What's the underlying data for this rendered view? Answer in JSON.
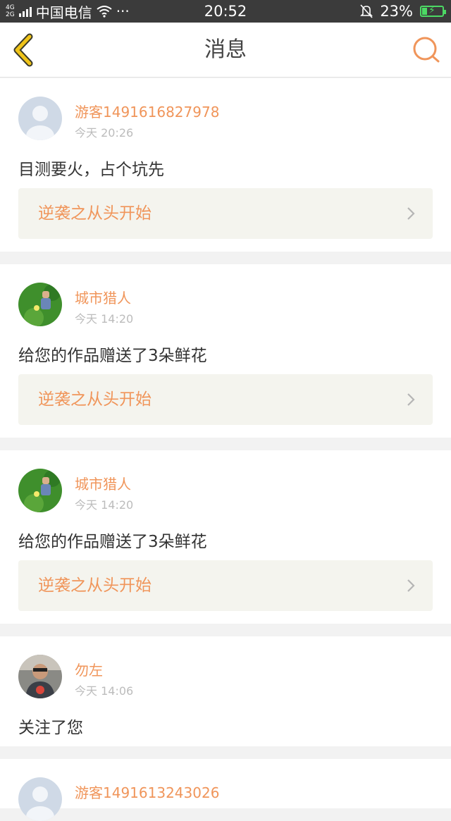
{
  "status_bar": {
    "network_top": "4G",
    "network_bottom": "2G",
    "carrier": "中国电信",
    "more": "···",
    "time": "20:52",
    "battery": "23%",
    "battery_level": 0.23
  },
  "header": {
    "title": "消息",
    "back_icon": "chevron-left-icon",
    "search_icon": "search-icon"
  },
  "colors": {
    "accent": "#f0955a",
    "back_icon": "#f0c419",
    "battery": "#4cd964"
  },
  "messages": [
    {
      "name": "游客1491616827978",
      "time": "今天 20:26",
      "text": "目测要火，占个坑先",
      "work": "逆袭之从头开始",
      "avatar": "default-avatar"
    },
    {
      "name": "城市猎人",
      "time": "今天 14:20",
      "text": "给您的作品赠送了3朵鲜花",
      "work": "逆袭之从头开始",
      "avatar": "game-character-avatar"
    },
    {
      "name": "城市猎人",
      "time": "今天 14:20",
      "text": "给您的作品赠送了3朵鲜花",
      "work": "逆袭之从头开始",
      "avatar": "game-character-avatar"
    },
    {
      "name": "勿左",
      "time": "今天 14:06",
      "text": "关注了您",
      "avatar": "photo-avatar"
    },
    {
      "name": "游客1491613243026",
      "avatar": "default-avatar"
    }
  ]
}
